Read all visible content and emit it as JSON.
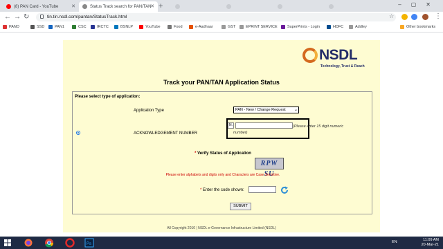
{
  "browser": {
    "tabs": [
      {
        "title": "(8) PAN Card - YouTube",
        "active": false
      },
      {
        "title": "Status Track search for PAN/TAN",
        "active": true
      },
      {
        "title": "",
        "active": false
      },
      {
        "title": "",
        "active": false
      },
      {
        "title": "",
        "active": false
      },
      {
        "title": "",
        "active": false
      }
    ],
    "url": "tin.tin.nsdl.com/pantan/StatusTrack.html",
    "bookmarks": [
      "PAND",
      "SSD",
      "PAN1",
      "CSC",
      "IRCTC",
      "BSNLP",
      "YouTube",
      "Food",
      "e-Aadhaar",
      "GST",
      "EPRINT SERVICE",
      "SuperPrints - Login",
      "HDFC",
      "Addley"
    ],
    "other_bookmarks": "Other bookmarks"
  },
  "page": {
    "logo_text": "NSDL",
    "logo_tagline": "Technology, Trust & Reach",
    "title": "Track your PAN/TAN Application Status",
    "form_heading": "Please select type of application:",
    "application_type_label": "Application Type",
    "application_type_value": "PAN - New / Change Request",
    "ack_label": "ACKNOWLEDGEMENT NUMBER",
    "ack_prefix": "N.",
    "ack_hint_1": "(Please enter 15 digit numeric",
    "ack_hint_2": "number)",
    "verify_label": "Verify Status of Application",
    "captcha_text": "RPW SU",
    "captcha_note": "Please enter alphabets and digits only and Characters are Case Sensitive.",
    "code_label": "Enter the code shown:",
    "submit_label": "SUBMIT",
    "footer": "All Copyright 2010  |  NSDL e-Governance Infrastructure Limited (NSDL)"
  },
  "taskbar": {
    "language": "EN",
    "time": "11:09 AM",
    "date": "20-Mar-21"
  }
}
